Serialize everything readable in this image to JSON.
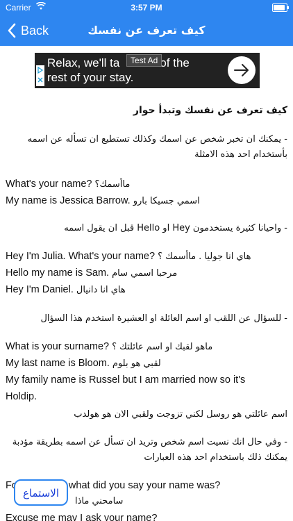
{
  "status": {
    "carrier": "Carrier",
    "time": "3:57 PM",
    "battery_level": 0.9
  },
  "nav": {
    "back_label": "Back",
    "title": "كيف تعرف عن نفسك"
  },
  "ad": {
    "line1": "Relax, we'll ta",
    "line1_tail": "of the",
    "line2": "rest of your stay.",
    "badge": "Test Ad",
    "icon": "adchoices-icon",
    "cta_icon": "arrow-right-icon"
  },
  "article": {
    "heading": "كيف تعرف عن نفسك وتبدأ حوار",
    "p1_l1": "- يمكنك ان تخبر شخص عن اسمك وكذلك تستطيع ان تسأله عن اسمه",
    "p1_l2": "بأستخدام احد هذه الامثلة",
    "ex1_en": "What's your name?",
    "ex1_ar": "ماأسمك؟",
    "ex2_en": "My name is Jessica Barrow.",
    "ex2_ar": "اسمي جسيكا بارو",
    "p2": "- واحيانا كثيرة يستخدمون Hey او Hello قبل ان يقول اسمه",
    "ex3_en": "Hey I'm Julia. What's your name?",
    "ex3_ar": "هاي انا جوليا . ماأسمك ؟",
    "ex4_en": "Hello my name is Sam.",
    "ex4_ar": "مرحبا اسمي سام",
    "ex5_en": "Hey I'm Daniel.",
    "ex5_ar": "هاي انا دانيال",
    "p3": "- للسؤال عن اللقب او اسم العائلة او العشيرة استخدم هذا السؤال",
    "ex6_en": "What is your surname?",
    "ex6_ar": "ماهو لقبك او اسم عائلتك ؟",
    "ex7_en": "My last name is Bloom.",
    "ex7_ar": "لقبي هو بلوم",
    "ex8_en_l1": "My family name is Russel but I am married now so it's",
    "ex8_en_l2": "Holdip.",
    "ex8_ar": "اسم عائلتي هو روسل لكني تزوجت ولقبي الان هو هولدب",
    "p4_l1": "- وفي حال انك نسيت اسم شخص وتريد ان تسأل عن اسمه بطريقة مؤدبة",
    "p4_l2": "يمكنك ذلك باستخدام احد هذه العبارات",
    "ex9_en_a": "Fo",
    "ex9_en_b": "what did you say your name was?",
    "ex9_ar": "سامحني ماذا",
    "ex10_en": "Excuse me may I ask your name?"
  },
  "listen_button": {
    "label": "الاستماع"
  },
  "colors": {
    "bar": "#2e86f0",
    "listen_text": "#1a3fd8"
  }
}
